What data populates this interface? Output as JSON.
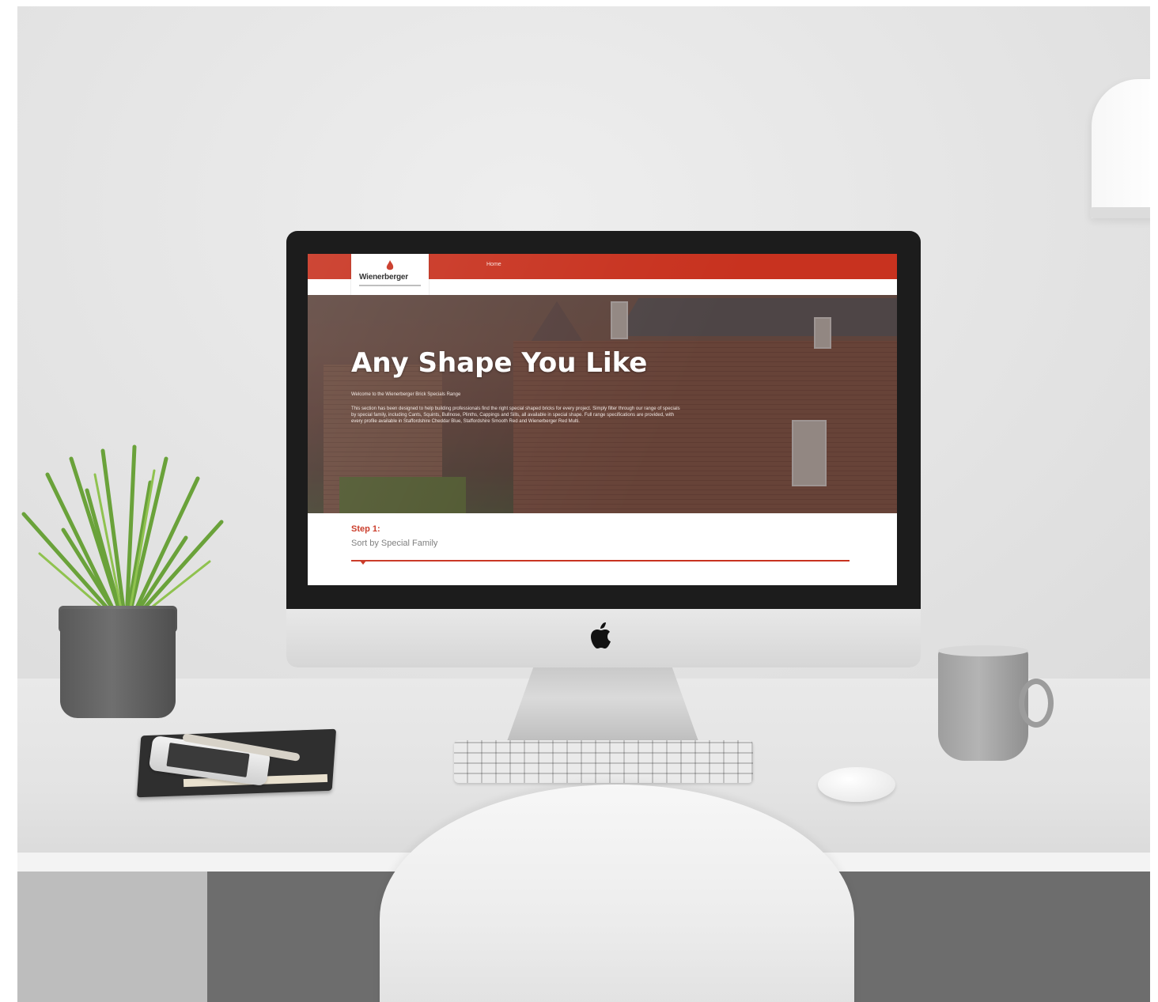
{
  "screen": {
    "nav": {
      "home_label": "Home"
    },
    "brand": {
      "name": "Wienerberger"
    },
    "hero": {
      "title": "Any Shape You Like",
      "intro": "Welcome to the Wienerberger Brick Specials Range",
      "body": "This section has been designed to help building professionals find the right special shaped bricks for every project. Simply filter through our range of specials by special family, including Cants, Squints, Bullnose, Plinths, Cappings and Sills, all available in special shape. Full range specifications are provided, with every profile available in Staffordshire Cheddar Blue, Staffordshire Smooth Red and Wienerberger Red Multi."
    },
    "step": {
      "label": "Step 1:",
      "sub": "Sort by Special Family"
    },
    "colors": {
      "brand_red": "#c8321f"
    }
  }
}
